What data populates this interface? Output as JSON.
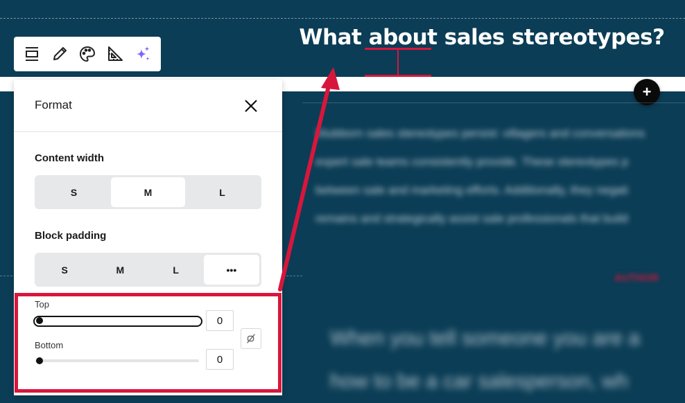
{
  "page": {
    "heading": "What about sales stereotypes?",
    "add_block_symbol": "+"
  },
  "background_text": {
    "body_lines": [
      "Stubborn sales stereotypes persist: villagers and conversations",
      "expert sale teams consistently provide. These stereotypes p",
      "between sale and marketing efforts. Additionally, they negati",
      "remains and strategically assist sale professionals that build"
    ],
    "author": "AUTHOR",
    "quote_lines": [
      "When you tell someone you are a",
      "how to be a car salesperson, wh"
    ]
  },
  "toolbar": {
    "items": [
      {
        "name": "align-icon",
        "label": "Alignment"
      },
      {
        "name": "pencil-icon",
        "label": "Edit"
      },
      {
        "name": "palette-icon",
        "label": "Style"
      },
      {
        "name": "ruler-triangle-icon",
        "label": "Format"
      },
      {
        "name": "sparkle-icon",
        "label": "AI"
      }
    ]
  },
  "format_panel": {
    "title": "Format",
    "content_width": {
      "label": "Content width",
      "options": [
        "S",
        "M",
        "L"
      ],
      "selected": "M"
    },
    "block_padding": {
      "label": "Block padding",
      "options": [
        "S",
        "M",
        "L",
        "•••"
      ],
      "selected": "•••"
    },
    "top": {
      "label": "Top",
      "value": "0"
    },
    "bottom": {
      "label": "Bottom",
      "value": "0"
    }
  },
  "colors": {
    "background": "#0b3d56",
    "annotation_red": "#d8163c",
    "sparkle_purple": "#6c63ff"
  }
}
